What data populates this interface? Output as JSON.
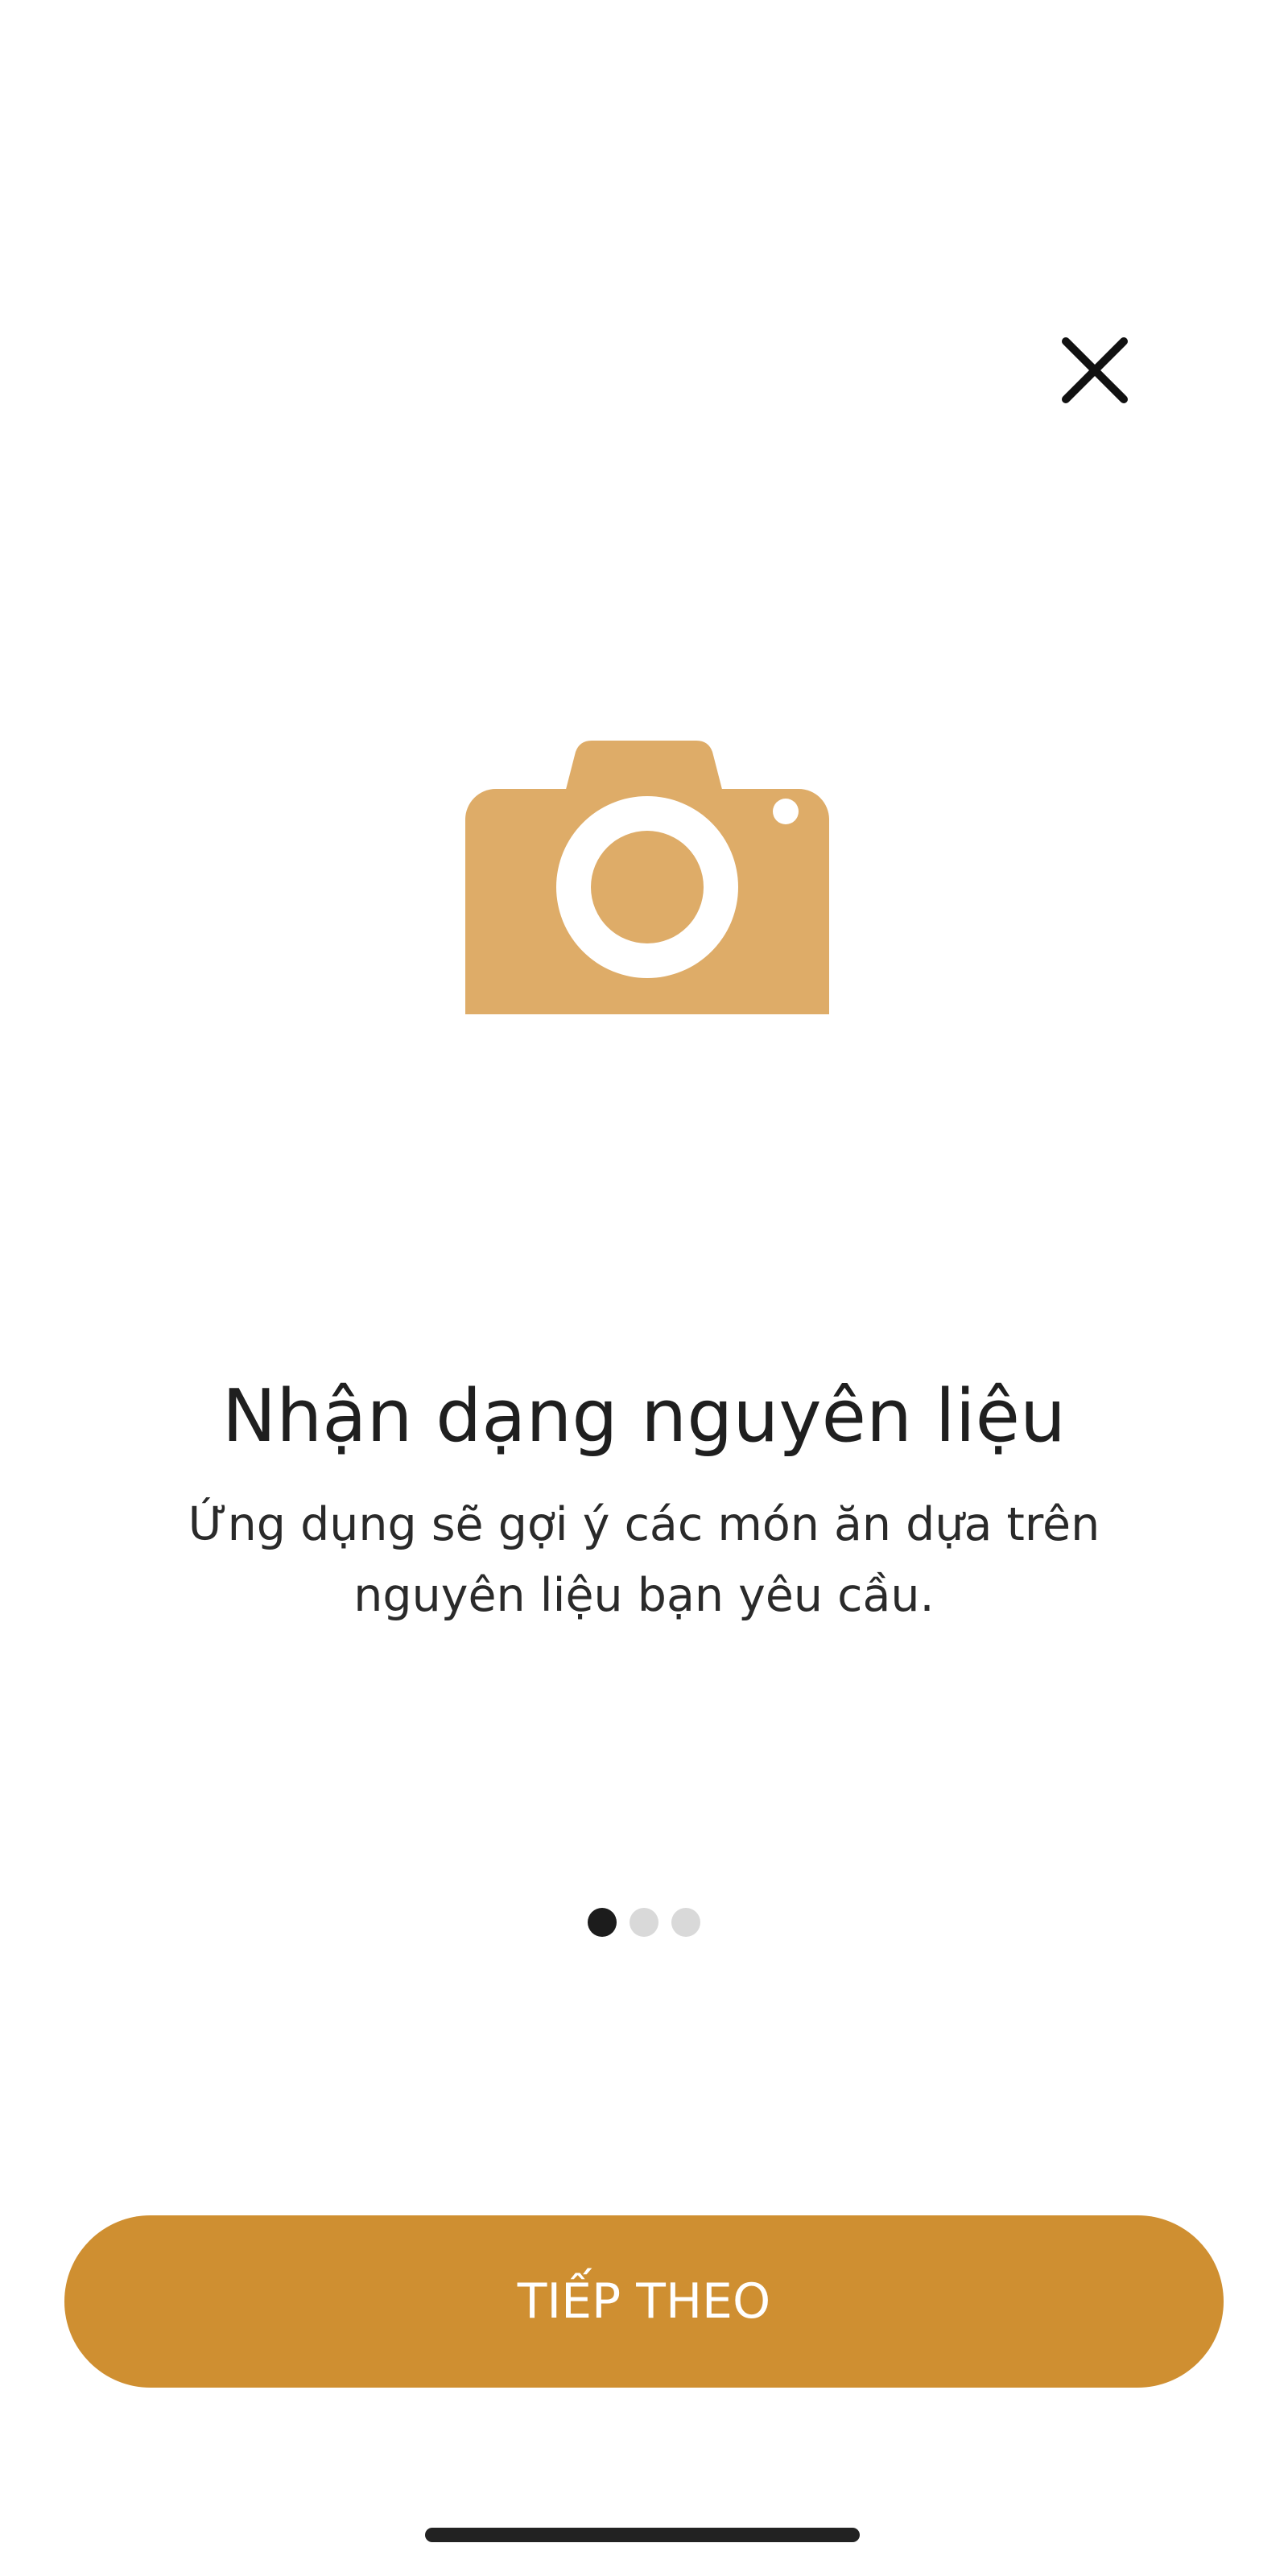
{
  "onboarding": {
    "title": "Nhận dạng nguyên liệu",
    "description": "Ứng dụng sẽ gợi ý các món ăn dựa trên nguyên liệu bạn yêu cầu.",
    "hero_icon": "camera-icon",
    "close_icon": "close-icon",
    "pager": {
      "current_page": 1,
      "total_pages": 3
    },
    "next_button_label": "TIẾP THEO"
  },
  "colors": {
    "accent": "#cf8f31",
    "hero_icon": "#deac68",
    "text": "#1f1f1f",
    "dot_active": "#1c1c1c",
    "dot_inactive": "#d9d9d9",
    "background": "#ffffff"
  }
}
